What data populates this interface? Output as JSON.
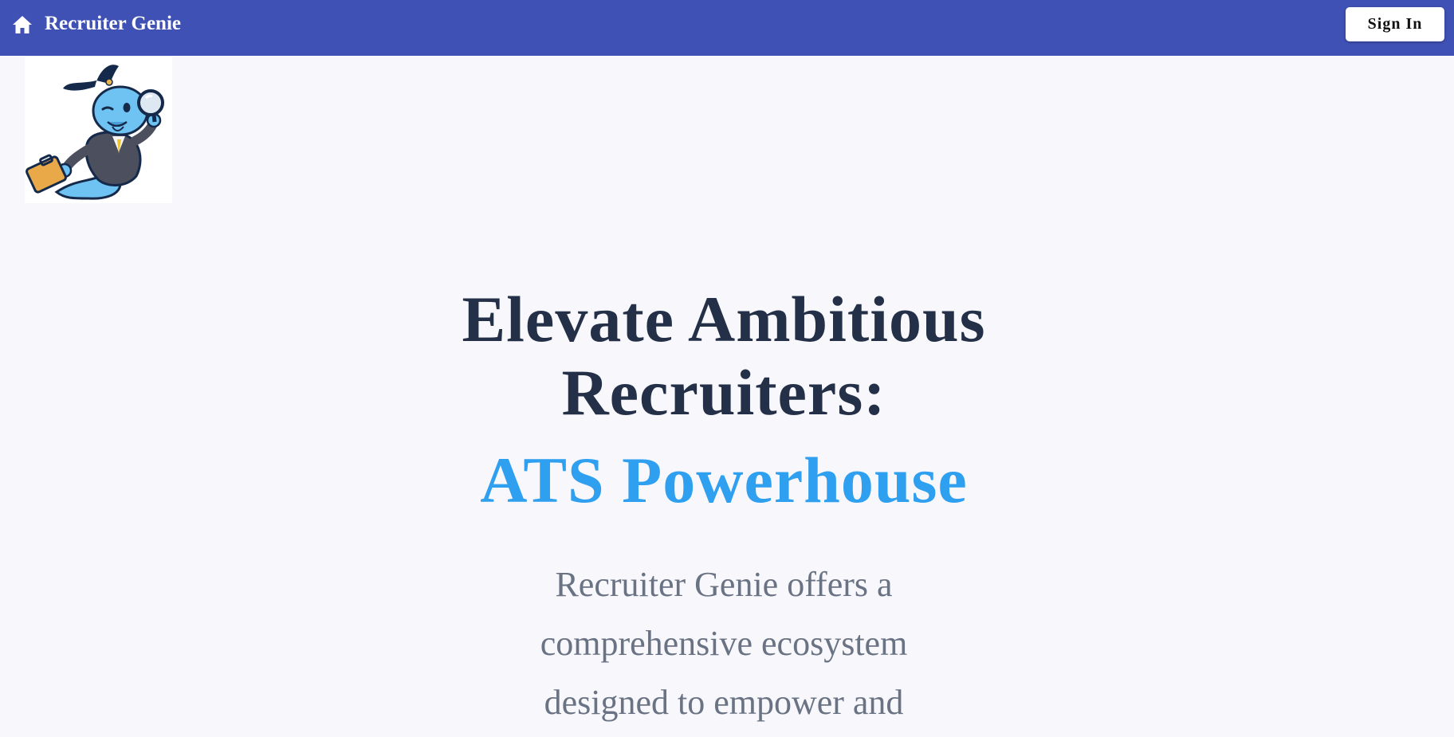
{
  "header": {
    "home_icon": "home-icon",
    "brand": "Recruiter Genie",
    "sign_in_label": "Sign In",
    "background_color": "#3f51b5"
  },
  "logo": {
    "image": "genie-mascot-with-briefcase-and-magnifying-glass"
  },
  "hero": {
    "headline_line1": "Elevate Ambitious",
    "headline_line2": "Recruiters:",
    "accent": "ATS Powerhouse",
    "accent_color": "#2f9ff0",
    "description_lines": [
      "Recruiter Genie offers a",
      "comprehensive ecosystem",
      "designed to empower and"
    ]
  }
}
